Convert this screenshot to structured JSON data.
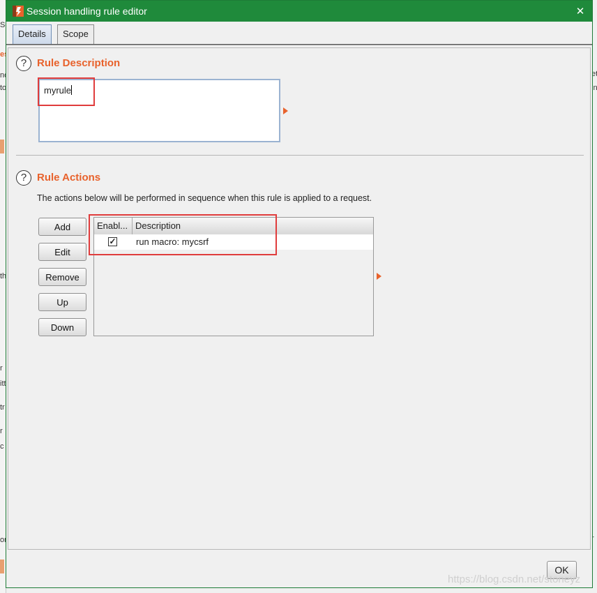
{
  "window": {
    "title": "Session handling rule editor",
    "close_glyph": "✕"
  },
  "tabs": [
    {
      "label": "Details",
      "active": true
    },
    {
      "label": "Scope",
      "active": false
    }
  ],
  "rule_description": {
    "help_glyph": "?",
    "title": "Rule Description",
    "value": "myrule"
  },
  "rule_actions": {
    "help_glyph": "?",
    "title": "Rule Actions",
    "description": "The actions below will be performed in sequence when this rule is applied to a request.",
    "buttons": {
      "add": "Add",
      "edit": "Edit",
      "remove": "Remove",
      "up": "Up",
      "down": "Down"
    },
    "table": {
      "columns": [
        "Enabl...",
        "Description"
      ],
      "rows": [
        {
          "enabled": true,
          "check_glyph": "✓",
          "description": "run macro: mycsrf"
        }
      ]
    }
  },
  "footer": {
    "ok_label": "OK"
  },
  "watermark": "https://blog.csdn.net/stoneyz",
  "colors": {
    "title_bar": "#1f8a3b",
    "section_title": "#e8622c",
    "highlight": "#e03c3c"
  },
  "background_fragments": [
    "Se",
    "es",
    "no",
    "to",
    "th",
    "r",
    "itt",
    "tr",
    "r",
    "c",
    "or",
    "et",
    "in",
    "r"
  ]
}
